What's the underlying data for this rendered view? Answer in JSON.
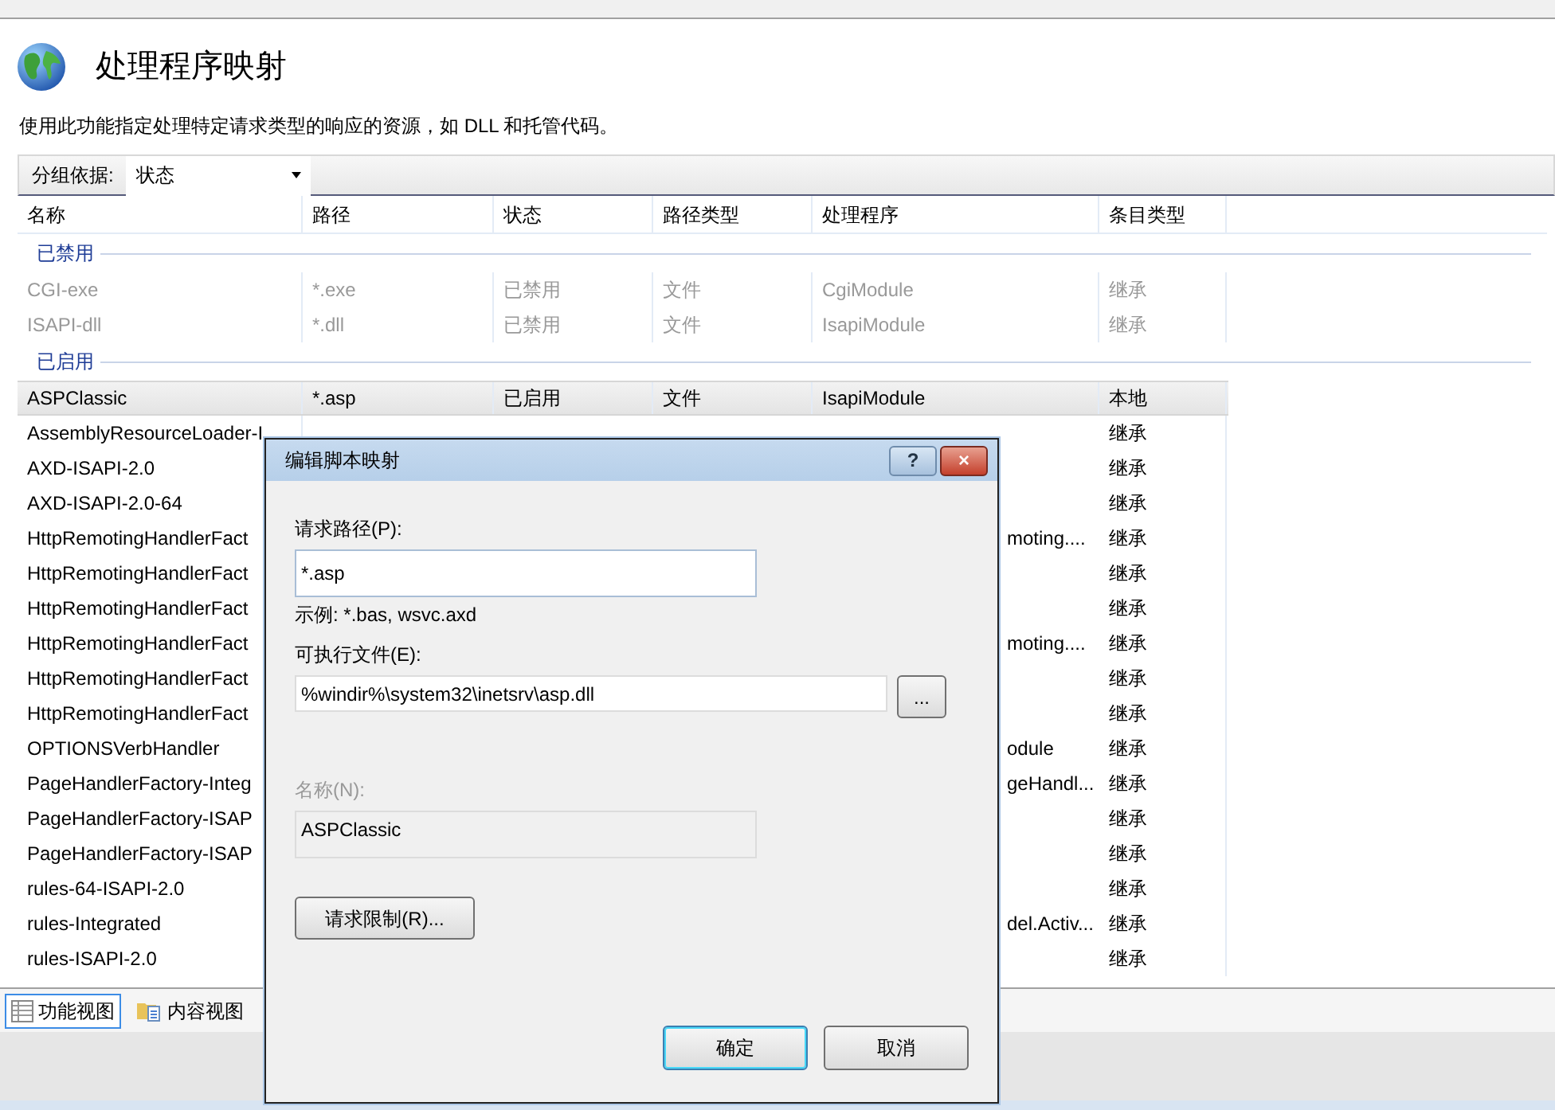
{
  "page": {
    "title": "处理程序映射",
    "description": "使用此功能指定处理特定请求类型的响应的资源，如 DLL 和托管代码。"
  },
  "group_by": {
    "label": "分组依据:",
    "value": "状态"
  },
  "table": {
    "columns": [
      "名称",
      "路径",
      "状态",
      "路径类型",
      "处理程序",
      "条目类型"
    ],
    "groups": [
      {
        "label": "已禁用",
        "rows": [
          {
            "name": "CGI-exe",
            "path": "*.exe",
            "state": "已禁用",
            "path_type": "文件",
            "handler": "CgiModule",
            "entry_type": "继承",
            "disabled": true,
            "selected": false
          },
          {
            "name": "ISAPI-dll",
            "path": "*.dll",
            "state": "已禁用",
            "path_type": "文件",
            "handler": "IsapiModule",
            "entry_type": "继承",
            "disabled": true,
            "selected": false
          }
        ]
      },
      {
        "label": "已启用",
        "rows": [
          {
            "name": "ASPClassic",
            "path": "*.asp",
            "state": "已启用",
            "path_type": "文件",
            "handler": "IsapiModule",
            "entry_type": "本地",
            "disabled": false,
            "selected": true
          },
          {
            "name": "AssemblyResourceLoader-I",
            "entry_type": "继承",
            "disabled": false,
            "selected": false
          },
          {
            "name": "AXD-ISAPI-2.0",
            "entry_type": "继承",
            "disabled": false,
            "selected": false
          },
          {
            "name": "AXD-ISAPI-2.0-64",
            "entry_type": "继承",
            "disabled": false,
            "selected": false
          },
          {
            "name": "HttpRemotingHandlerFact",
            "handler": "moting....",
            "entry_type": "继承",
            "disabled": false,
            "selected": false
          },
          {
            "name": "HttpRemotingHandlerFact",
            "entry_type": "继承",
            "disabled": false,
            "selected": false
          },
          {
            "name": "HttpRemotingHandlerFact",
            "entry_type": "继承",
            "disabled": false,
            "selected": false
          },
          {
            "name": "HttpRemotingHandlerFact",
            "handler": "moting....",
            "entry_type": "继承",
            "disabled": false,
            "selected": false
          },
          {
            "name": "HttpRemotingHandlerFact",
            "entry_type": "继承",
            "disabled": false,
            "selected": false
          },
          {
            "name": "HttpRemotingHandlerFact",
            "entry_type": "继承",
            "disabled": false,
            "selected": false
          },
          {
            "name": "OPTIONSVerbHandler",
            "handler": "odule",
            "entry_type": "继承",
            "disabled": false,
            "selected": false
          },
          {
            "name": "PageHandlerFactory-Integ",
            "handler": "geHandl...",
            "entry_type": "继承",
            "disabled": false,
            "selected": false
          },
          {
            "name": "PageHandlerFactory-ISAP",
            "entry_type": "继承",
            "disabled": false,
            "selected": false
          },
          {
            "name": "PageHandlerFactory-ISAP",
            "entry_type": "继承",
            "disabled": false,
            "selected": false
          },
          {
            "name": "rules-64-ISAPI-2.0",
            "entry_type": "继承",
            "disabled": false,
            "selected": false
          },
          {
            "name": "rules-Integrated",
            "handler": "del.Activ...",
            "entry_type": "继承",
            "disabled": false,
            "selected": false
          },
          {
            "name": "rules-ISAPI-2.0",
            "entry_type": "继承",
            "disabled": false,
            "selected": false
          }
        ]
      }
    ]
  },
  "view_tabs": [
    {
      "label": "功能视图",
      "selected": true
    },
    {
      "label": "内容视图",
      "selected": false
    }
  ],
  "dialog": {
    "title": "编辑脚本映射",
    "help_button": "?",
    "close_button": "×",
    "fields": [
      {
        "label": "请求路径(P):",
        "value": "*.asp",
        "hint": "示例: *.bas, wsvc.axd",
        "disabled": false
      },
      {
        "label": "可执行文件(E):",
        "value": "%windir%\\system32\\inetsrv\\asp.dll",
        "browse_button": "...",
        "disabled": false
      },
      {
        "label": "名称(N):",
        "value": "ASPClassic",
        "disabled": true
      }
    ],
    "restrictions_button": "请求限制(R)...",
    "buttons": [
      {
        "label": "确定",
        "default": true
      },
      {
        "label": "取消",
        "default": false
      }
    ]
  }
}
